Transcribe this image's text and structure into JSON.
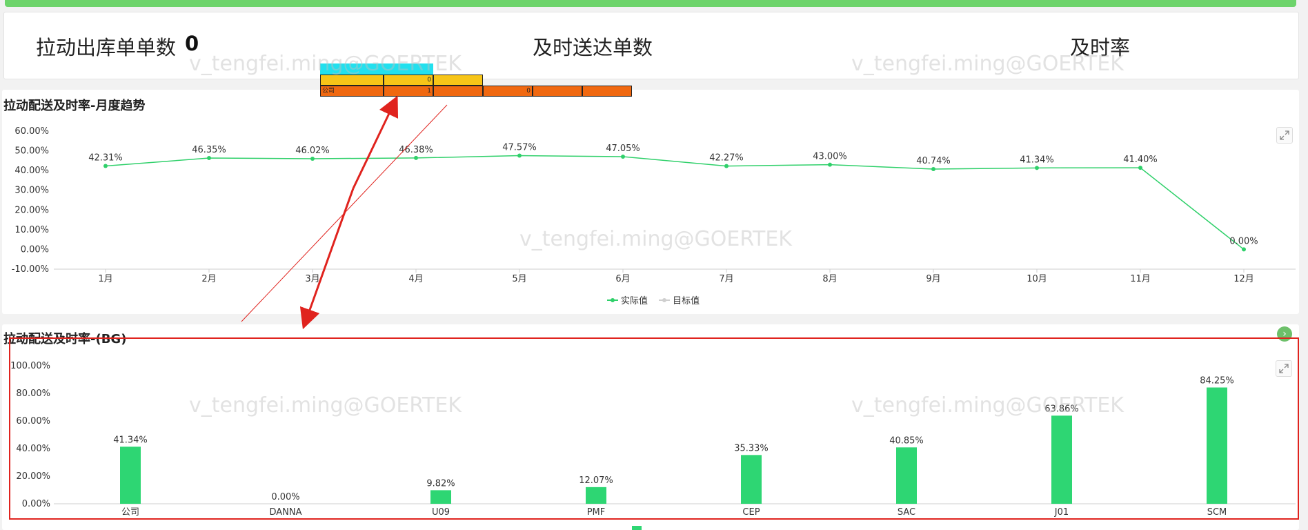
{
  "kpi": {
    "pull_outbound_label": "拉动出库单单数",
    "pull_outbound_value": "0",
    "on_time_label": "及时送达单数",
    "rate_label": "及时率"
  },
  "watermark": "v_tengfei.ming@GOERTEK",
  "popup": {
    "row1": [
      "",
      "0",
      ""
    ],
    "row2": [
      "公司",
      "1",
      "",
      "0",
      "",
      ""
    ]
  },
  "monthly": {
    "title": "拉动配送及时率-月度趋势",
    "legend": [
      "实际值",
      "目标值"
    ]
  },
  "bg": {
    "title": "拉动配送及时率-(BG)"
  },
  "colors": {
    "line": "#2fd06a",
    "bar": "#2ed673",
    "annotation": "#e0231e",
    "top_bar": "#6dd46b"
  },
  "chart_data": [
    {
      "type": "line",
      "title": "拉动配送及时率-月度趋势",
      "categories": [
        "1月",
        "2月",
        "3月",
        "4月",
        "5月",
        "6月",
        "7月",
        "8月",
        "9月",
        "10月",
        "11月",
        "12月"
      ],
      "series": [
        {
          "name": "实际值",
          "values": [
            42.31,
            46.35,
            46.02,
            46.38,
            47.57,
            47.05,
            42.27,
            43.0,
            40.74,
            41.34,
            41.4,
            0.0
          ],
          "labels": [
            "42.31%",
            "46.35%",
            "46.02%",
            "46.38%",
            "47.57%",
            "47.05%",
            "42.27%",
            "43.00%",
            "40.74%",
            "41.34%",
            "41.40%",
            "0.00%"
          ]
        },
        {
          "name": "目标值",
          "values": []
        }
      ],
      "yticks": [
        "60.00%",
        "50.00%",
        "40.00%",
        "30.00%",
        "20.00%",
        "10.00%",
        "0.00%",
        "-10.00%"
      ],
      "ylim": [
        -10,
        60
      ],
      "grid": false,
      "legend": "bottom-center"
    },
    {
      "type": "bar",
      "title": "拉动配送及时率-(BG)",
      "categories": [
        "公司",
        "DANNA",
        "U09",
        "PMF",
        "CEP",
        "SAC",
        "J01",
        "SCM"
      ],
      "series": [
        {
          "name": "实际值",
          "values": [
            41.34,
            0.0,
            9.82,
            12.07,
            35.33,
            40.85,
            63.86,
            84.25
          ],
          "labels": [
            "41.34%",
            "0.00%",
            "9.82%",
            "12.07%",
            "35.33%",
            "40.85%",
            "63.86%",
            "84.25%"
          ]
        }
      ],
      "yticks": [
        "100.00%",
        "80.00%",
        "60.00%",
        "40.00%",
        "20.00%",
        "0.00%"
      ],
      "ylim": [
        0,
        100
      ],
      "grid": false
    }
  ]
}
